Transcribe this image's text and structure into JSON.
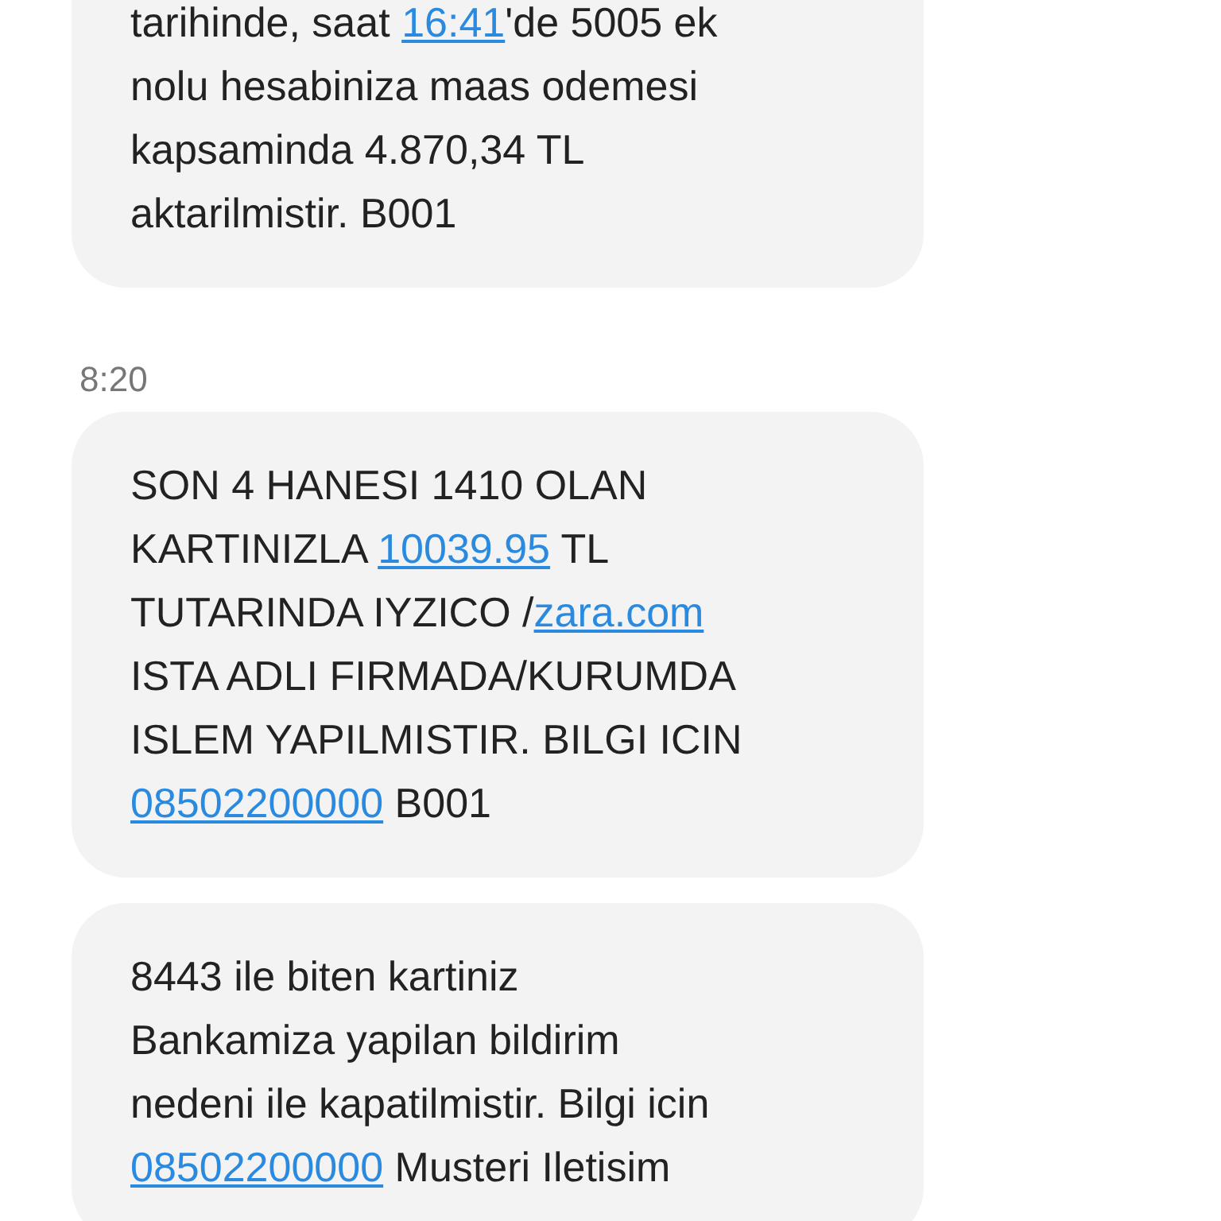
{
  "messages": [
    {
      "lines": [
        [
          {
            "kind": "text",
            "text": "tarihinde, saat "
          },
          {
            "kind": "link",
            "text": "16:41"
          },
          {
            "kind": "text",
            "text": "'de 5005 ek"
          }
        ],
        [
          {
            "kind": "text",
            "text": "nolu hesabiniza maas odemesi"
          }
        ],
        [
          {
            "kind": "text",
            "text": "kapsaminda 4.870,34 TL"
          }
        ],
        [
          {
            "kind": "text",
            "text": "aktarilmistir. B001"
          }
        ]
      ]
    },
    {
      "time": "8:20",
      "lines": [
        [
          {
            "kind": "text",
            "text": "SON 4 HANESI 1410 OLAN"
          }
        ],
        [
          {
            "kind": "text",
            "text": "KARTINIZLA "
          },
          {
            "kind": "link",
            "text": "10039.95"
          },
          {
            "kind": "text",
            "text": " TL"
          }
        ],
        [
          {
            "kind": "text",
            "text": "TUTARINDA IYZICO /"
          },
          {
            "kind": "link",
            "text": "zara.com"
          }
        ],
        [
          {
            "kind": "text",
            "text": "ISTA ADLI FIRMADA/KURUMDA"
          }
        ],
        [
          {
            "kind": "text",
            "text": "ISLEM YAPILMISTIR. BILGI ICIN"
          }
        ],
        [
          {
            "kind": "link",
            "text": "08502200000"
          },
          {
            "kind": "text",
            "text": " B001"
          }
        ]
      ]
    },
    {
      "lines": [
        [
          {
            "kind": "text",
            "text": "8443 ile biten kartiniz"
          }
        ],
        [
          {
            "kind": "text",
            "text": "Bankamiza yapilan bildirim"
          }
        ],
        [
          {
            "kind": "text",
            "text": "nedeni ile kapatilmistir. Bilgi icin"
          }
        ],
        [
          {
            "kind": "link",
            "text": "08502200000"
          },
          {
            "kind": "text",
            "text": " Musteri Iletisim"
          }
        ]
      ]
    }
  ]
}
